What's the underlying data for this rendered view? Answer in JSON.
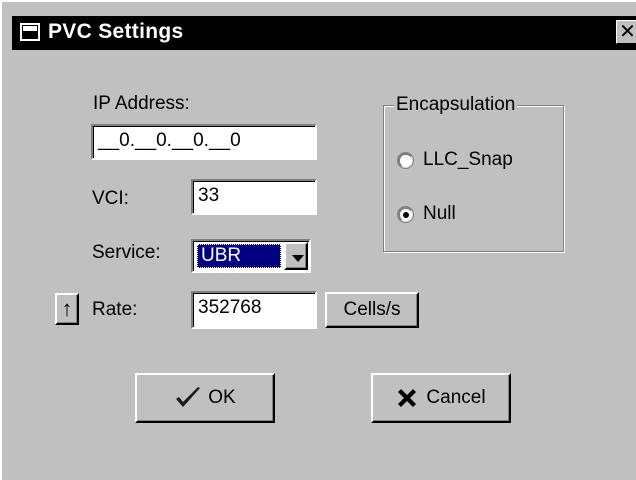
{
  "window": {
    "title": "PVC Settings",
    "close_glyph": "✕"
  },
  "form": {
    "ip_label": "IP Address:",
    "ip_value": "__0.__0.__0.__0",
    "vci_label": "VCI:",
    "vci_value": "33",
    "service_label": "Service:",
    "service_value": "UBR",
    "rate_label": "Rate:",
    "rate_value": "352768",
    "rate_unit_button": "Cells/s",
    "rate_toggle_glyph": "↑"
  },
  "encapsulation": {
    "legend": "Encapsulation",
    "options": [
      {
        "label": "LLC_Snap",
        "checked": false
      },
      {
        "label": "Null",
        "checked": true
      }
    ]
  },
  "buttons": {
    "ok_label": "OK",
    "cancel_label": "Cancel"
  },
  "icons": {
    "ok": "checkmark-icon",
    "cancel": "x-icon",
    "title": "window-icon"
  },
  "colors": {
    "titlebar": "#000000",
    "face": "#c0c0c0",
    "selection": "#000080",
    "ok_check": "#1a1a1a"
  }
}
